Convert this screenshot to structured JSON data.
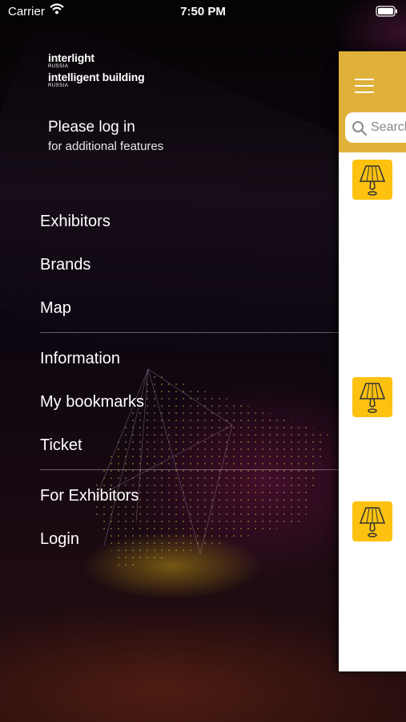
{
  "status_bar": {
    "carrier": "Carrier",
    "time": "7:50 PM"
  },
  "logo": {
    "line1": "interlight",
    "line1_sub": "RUSSIA",
    "line2": "intelligent building",
    "line2_sub": "RUSSIA"
  },
  "login_prompt": {
    "title": "Please log in",
    "subtitle": "for additional features"
  },
  "menu": {
    "group1": [
      "Exhibitors",
      "Brands",
      "Map"
    ],
    "group2": [
      "Information",
      "My bookmarks",
      "Ticket"
    ],
    "group3": [
      "For Exhibitors",
      "Login"
    ]
  },
  "content_panel": {
    "search_placeholder": "Search",
    "accent_color": "#e0b13a",
    "lamp_tile_color": "#fdc210",
    "list_icons": [
      "lamp-icon",
      "lamp-icon",
      "lamp-icon"
    ]
  }
}
